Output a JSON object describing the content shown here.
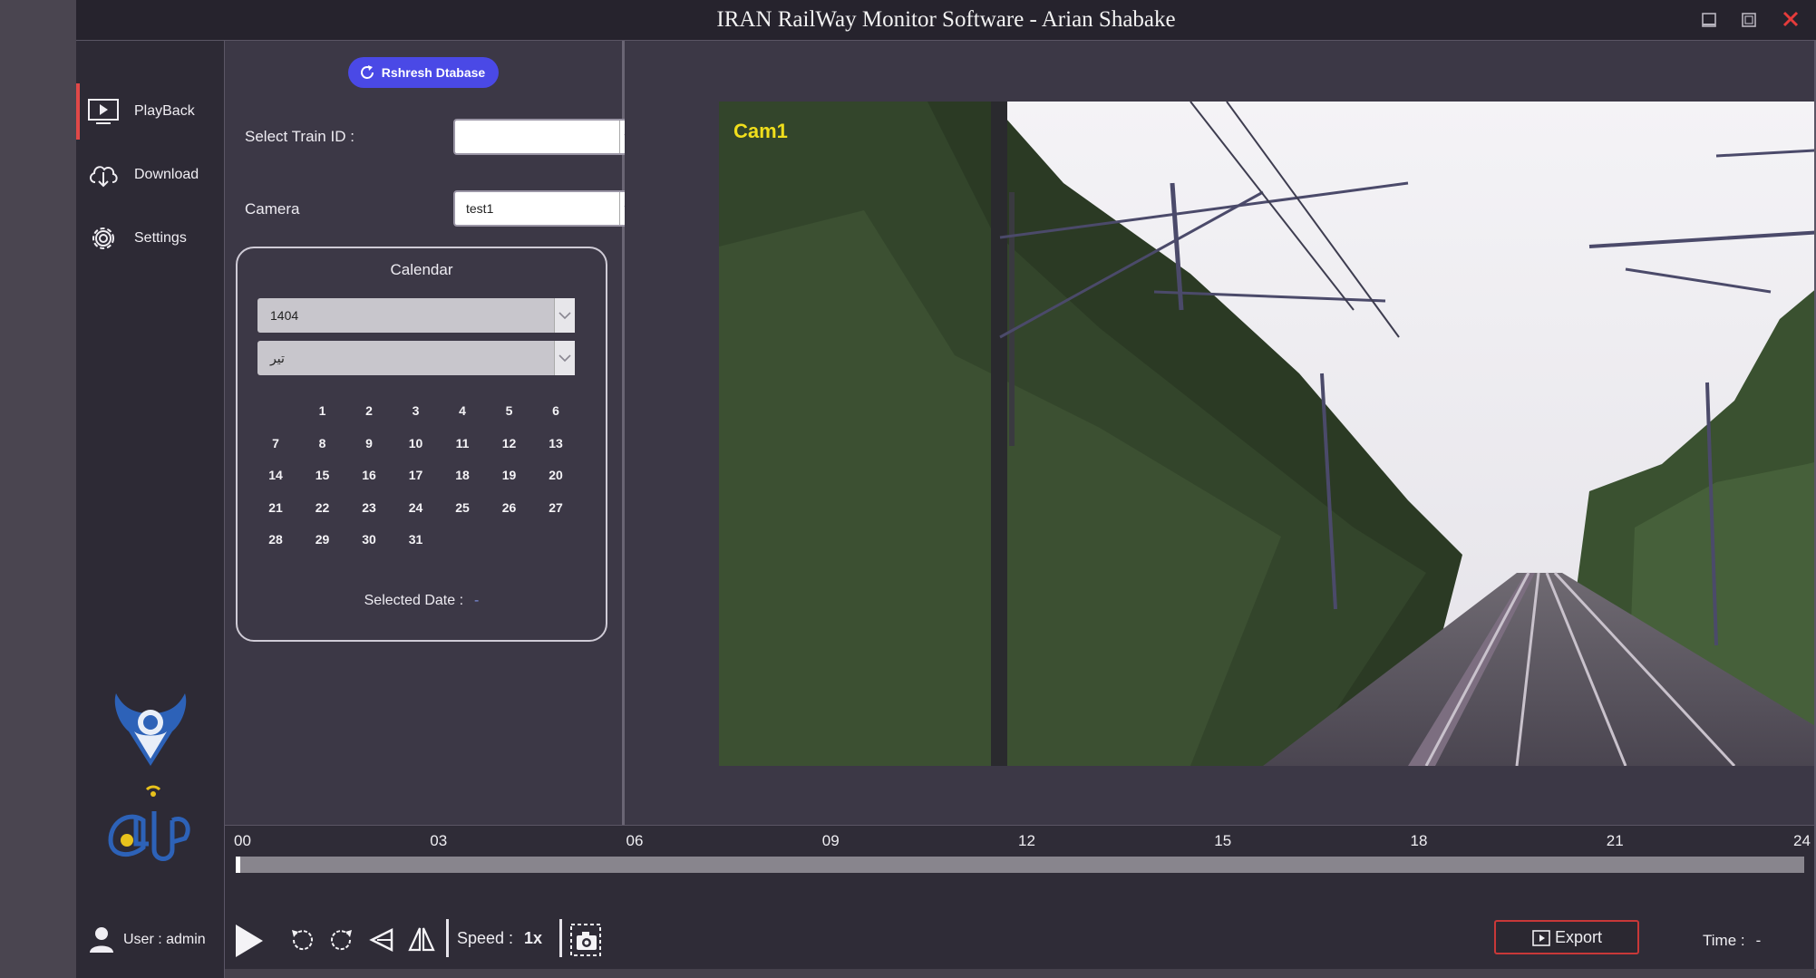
{
  "window": {
    "title": "IRAN RailWay Monitor Software - Arian Shabake"
  },
  "sidebar": {
    "items": [
      {
        "label": "PlayBack",
        "icon": "monitor-play-icon"
      },
      {
        "label": "Download",
        "icon": "cloud-download-icon"
      },
      {
        "label": "Settings",
        "icon": "gear-icon"
      }
    ],
    "user_label": "User : admin"
  },
  "panel": {
    "refresh_label": "Rshresh Dtabase",
    "train_label": "Select Train ID :",
    "train_value": "",
    "camera_label": "Camera",
    "camera_value": "test1",
    "calendar": {
      "title": "Calendar",
      "year": "1404",
      "month": "تیر",
      "days": [
        "1",
        "2",
        "3",
        "4",
        "5",
        "6",
        "7",
        "8",
        "9",
        "10",
        "11",
        "12",
        "13",
        "14",
        "15",
        "16",
        "17",
        "18",
        "19",
        "20",
        "21",
        "22",
        "23",
        "24",
        "25",
        "26",
        "27",
        "28",
        "29",
        "30",
        "31"
      ],
      "selected_date_label": "Selected Date :",
      "selected_date_value": "-"
    }
  },
  "video": {
    "camera_overlay": "Cam1"
  },
  "timeline": {
    "ticks": [
      "00",
      "03",
      "06",
      "09",
      "12",
      "15",
      "18",
      "21",
      "24"
    ],
    "position_fraction": 0
  },
  "controls": {
    "speed_label": "Speed :",
    "speed_value": "1x",
    "export_label": "Export",
    "time_label": "Time :",
    "time_value": "-"
  },
  "colors": {
    "accent_blue": "#4a49e6",
    "active_red": "#e04848",
    "export_border": "#c83838",
    "cam_label": "#f0de1c"
  }
}
